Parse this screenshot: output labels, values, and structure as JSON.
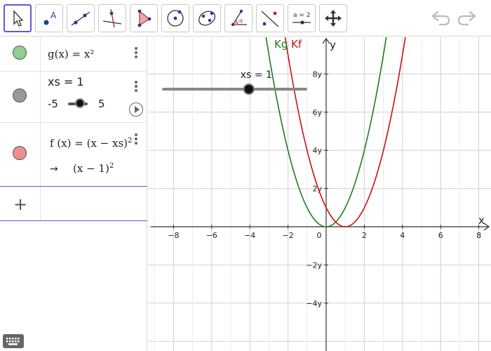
{
  "toolbar": {
    "tools": [
      {
        "name": "move-tool",
        "icon": "move-arrow-icon"
      },
      {
        "name": "point-tool",
        "icon": "point-icon",
        "label": "A"
      },
      {
        "name": "line-tool",
        "icon": "line-icon"
      },
      {
        "name": "perpendicular-line-tool",
        "icon": "perpendicular-line-icon"
      },
      {
        "name": "polygon-tool",
        "icon": "polygon-icon"
      },
      {
        "name": "circle-tool",
        "icon": "circle-icon"
      },
      {
        "name": "ellipse-tool",
        "icon": "ellipse-icon"
      },
      {
        "name": "angle-tool",
        "icon": "angle-icon",
        "label": "α"
      },
      {
        "name": "reflect-tool",
        "icon": "reflect-icon"
      },
      {
        "name": "slider-tool",
        "icon": "slider-icon",
        "label": "a = 2"
      },
      {
        "name": "move-graphics-tool",
        "icon": "move-graphics-icon"
      }
    ],
    "undo_icon": "undo-icon",
    "redo_icon": "redo-icon"
  },
  "algebra": {
    "items": [
      {
        "color": "#8fd08f",
        "text": "g(x)  =  x²"
      },
      {
        "color": "#999999",
        "label": "xs = 1",
        "slider_min": "-5",
        "slider_max": "5",
        "slider_value": 1
      },
      {
        "color": "#ee8f8f",
        "text": "f (x)  =  (x − xs)",
        "exponent": "2",
        "result_arrow": "→",
        "result": "(x − 1)",
        "result_exponent": "2"
      }
    ],
    "add_label": "+"
  },
  "graphics": {
    "slider_label": "xs = 1",
    "slider_value": 1,
    "slider_min": -5,
    "slider_max": 5,
    "x_axis_name": "x",
    "y_axis_name": "y",
    "x_ticks": [
      "−8",
      "−6",
      "−4",
      "−2",
      "0",
      "2",
      "4",
      "6",
      "8"
    ],
    "y_ticks": [
      "8y",
      "6y",
      "4y",
      "2y",
      "−2y",
      "−4y"
    ],
    "curve_labels": [
      {
        "text": "Kg",
        "color": "#1e7d1e"
      },
      {
        "text": "Kf",
        "color": "#cc1111"
      }
    ]
  },
  "chart_data": {
    "type": "line",
    "title": "",
    "xlabel": "x",
    "ylabel": "y",
    "xlim": [
      -9,
      9
    ],
    "ylim": [
      -6,
      10
    ],
    "grid": true,
    "series": [
      {
        "name": "Kg",
        "formula": "x^2",
        "color": "#1e7d1e",
        "x": [
          -3,
          -2,
          -1,
          0,
          1,
          2,
          3
        ],
        "y": [
          9,
          4,
          1,
          0,
          1,
          4,
          9
        ]
      },
      {
        "name": "Kf",
        "formula": "(x-1)^2",
        "color": "#cc1111",
        "x": [
          -2,
          -1,
          0,
          1,
          2,
          3,
          4
        ],
        "y": [
          9,
          4,
          1,
          0,
          1,
          4,
          9
        ]
      }
    ]
  }
}
